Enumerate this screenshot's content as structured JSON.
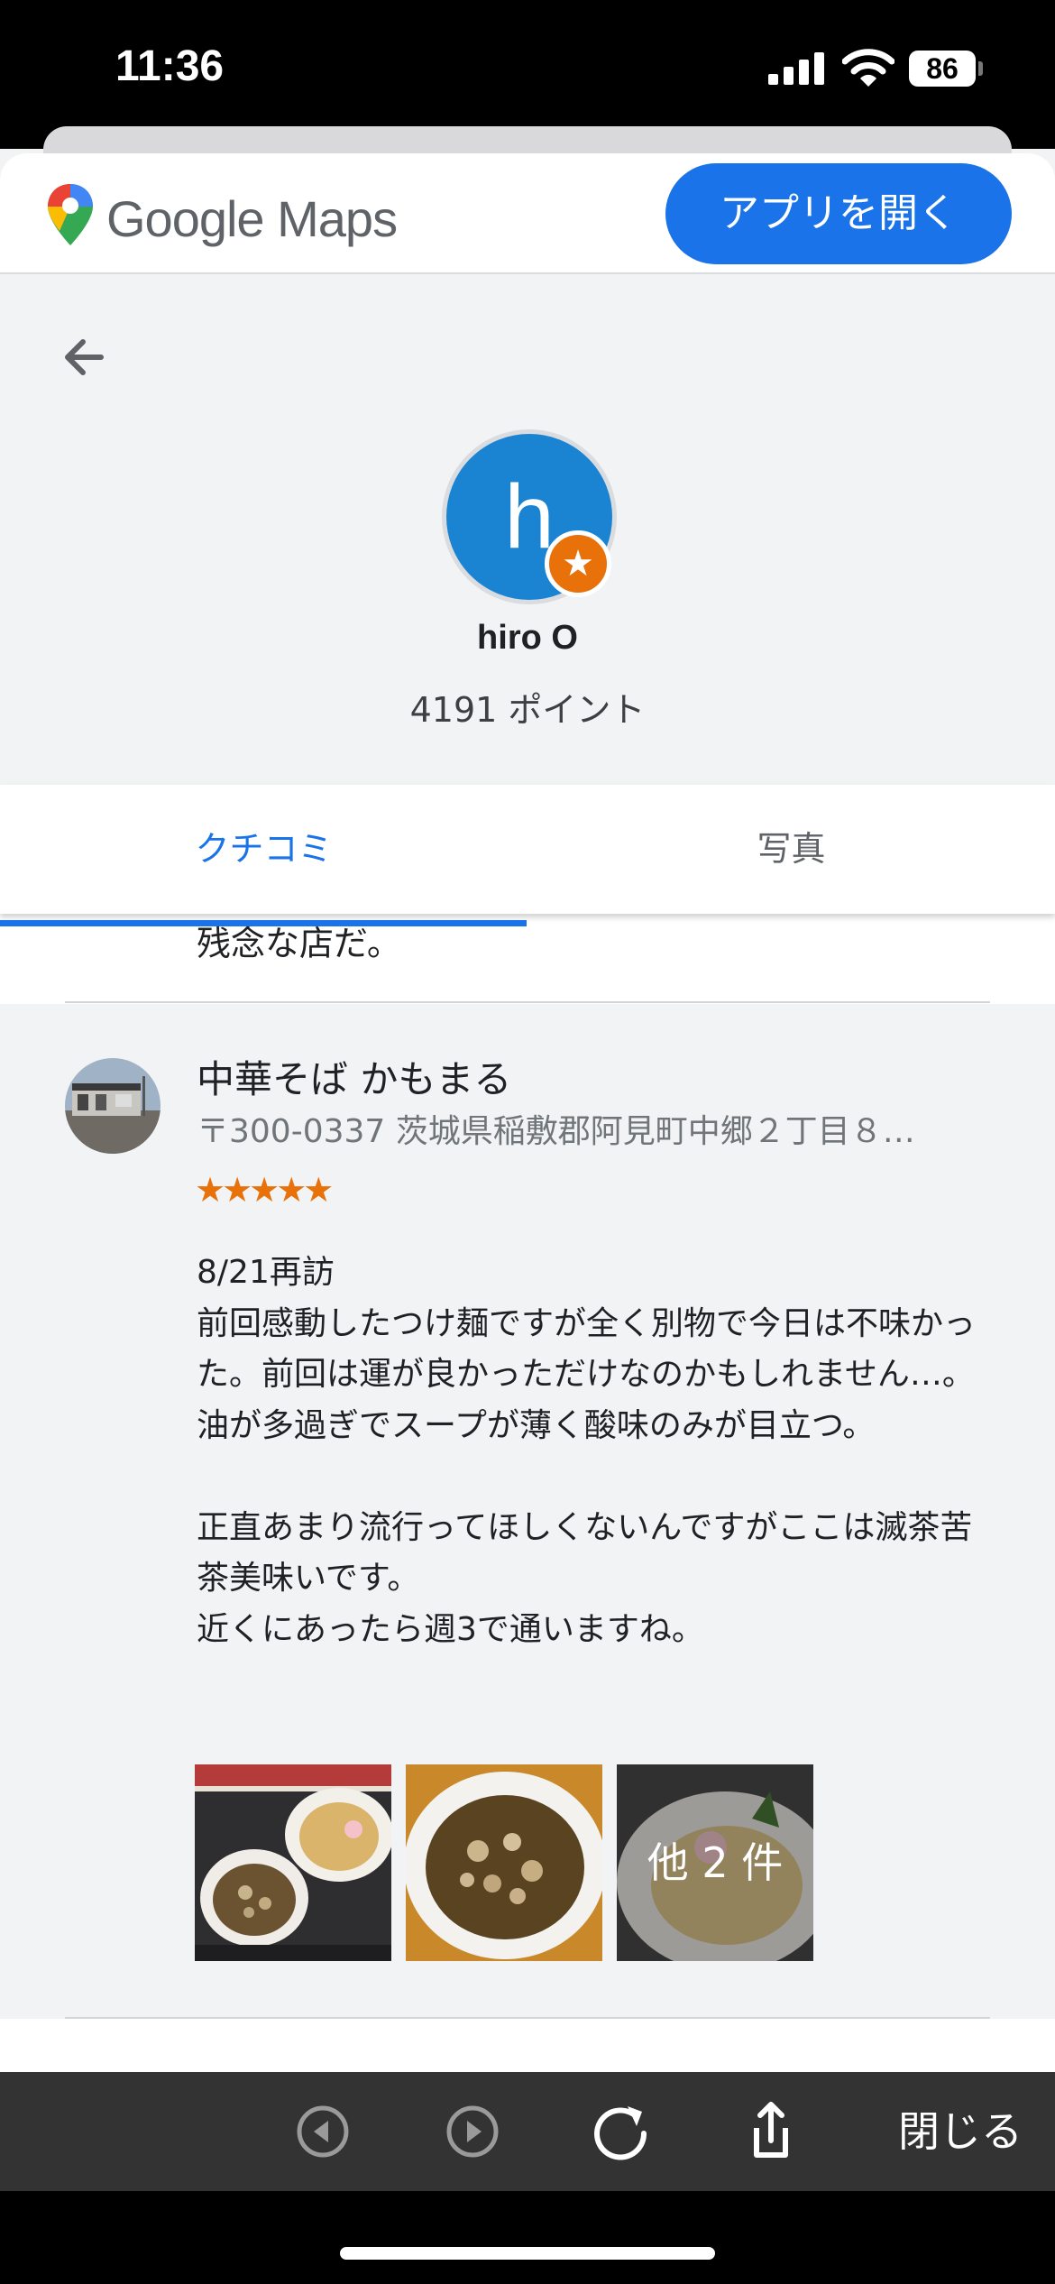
{
  "status_bar": {
    "time": "11:36",
    "battery": "86"
  },
  "header": {
    "logo_text": "Google Maps",
    "open_app_label": "アプリを開く",
    "accent": "#1a73e8"
  },
  "profile": {
    "avatar_letter": "h",
    "name": "hiro O",
    "points": "4191 ポイント",
    "avatar_color": "#1a84d3",
    "badge_color": "#e8710a",
    "badge_icon": "local-guide-star-icon"
  },
  "tabs": [
    {
      "label": "クチコミ",
      "active": true
    },
    {
      "label": "写真",
      "active": false
    }
  ],
  "previous_review_fragment": "残念な店だ。",
  "review": {
    "place_name": "中華そば かもまる",
    "address": "〒300-0337 茨城県稲敷郡阿見町中郷２丁目８…",
    "stars": "★★★★★",
    "rating": 5,
    "text": "8/21再訪\n前回感動したつけ麺ですが全く別物で今日は不味かった。前回は運が良かっただけなのかもしれません…。油が多過ぎでスープが薄く酸味のみが目立つ。\n\n正直あまり流行ってほしくないんですがここは滅茶苦茶美味いです。\n近くにあったら週3で通いますね。",
    "more_photos_label": "他 2 件"
  },
  "toolbar": {
    "close_label": "閉じる"
  }
}
